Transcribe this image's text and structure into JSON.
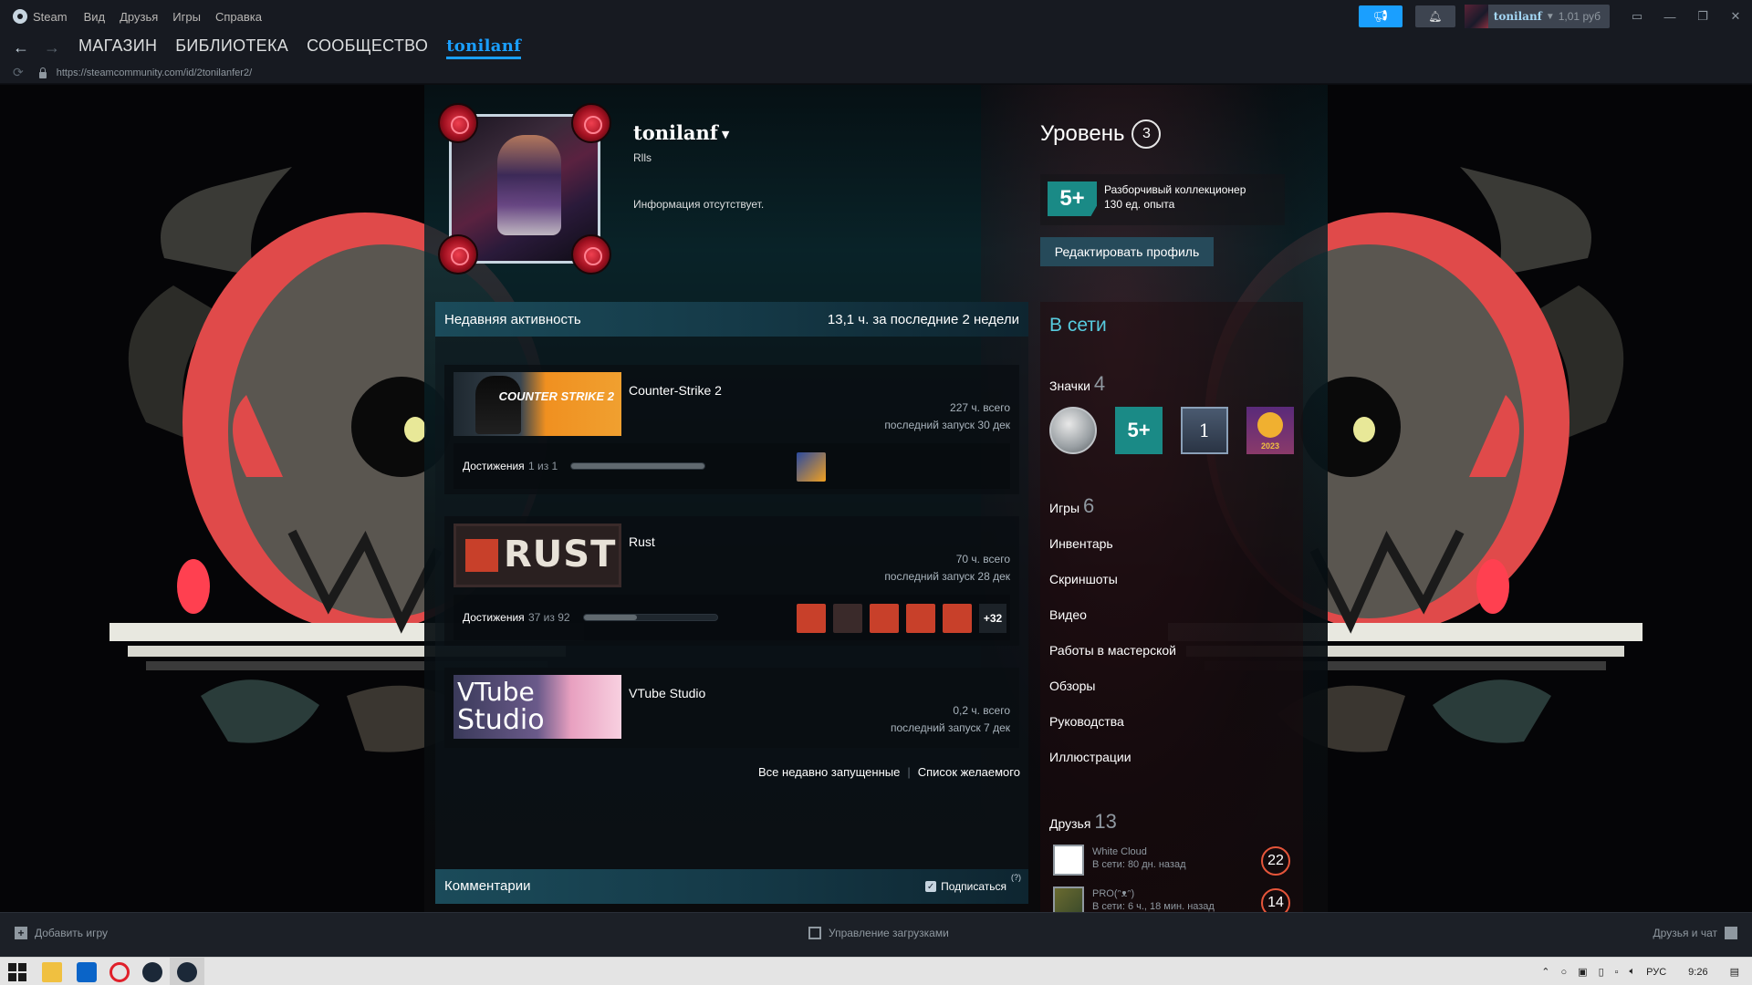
{
  "menubar": {
    "app": "Steam",
    "items": [
      "Вид",
      "Друзья",
      "Игры",
      "Справка"
    ],
    "user_name": "tonilanf",
    "balance": "1,01 руб"
  },
  "nav": {
    "links": [
      "МАГАЗИН",
      "БИБЛИОТЕКА",
      "СООБЩЕСТВО"
    ],
    "active": "tonilanf"
  },
  "url": "https://steamcommunity.com/id/2tonilanfer2/",
  "profile": {
    "name": "tonilanf",
    "real_name": "Rlls",
    "summary": "Информация отсутствует.",
    "level_label": "Уровень",
    "level": "3",
    "badge_symbol": "5+",
    "badge_name": "Разборчивый коллекционер",
    "badge_xp": "130 ед. опыта",
    "edit_button": "Редактировать профиль"
  },
  "activity": {
    "title": "Недавняя активность",
    "summary": "13,1 ч. за последние 2 недели",
    "achievements_label": "Достижения",
    "games": [
      {
        "name": "Counter-Strike 2",
        "thumb_text": "COUNTER STRIKE 2",
        "hours": "227 ч. всего",
        "last": "последний запуск 30 дек",
        "ach_count": "1 из 1",
        "ach_fraction": 1.0
      },
      {
        "name": "Rust",
        "thumb_text": "RUST",
        "hours": "70 ч. всего",
        "last": "последний запуск 28 дек",
        "ach_count": "37 из 92",
        "ach_fraction": 0.4,
        "more": "+32"
      },
      {
        "name": "VTube Studio",
        "thumb_text_1": "VTube",
        "thumb_text_2": "Studio",
        "hours": "0,2 ч. всего",
        "last": "последний запуск 7 дек"
      }
    ],
    "link_recent": "Все недавно запущенные",
    "link_sep": "|",
    "link_wishlist": "Список желаемого"
  },
  "comments": {
    "title": "Комментарии",
    "subscribe": "Подписаться",
    "help": "(?)"
  },
  "sidebar": {
    "status": "В сети",
    "badges_label": "Значки",
    "badges_count": "4",
    "badge_5": "5+",
    "badge_1": "1",
    "badge_year": "2023",
    "games_label": "Игры",
    "games_count": "6",
    "links": [
      "Инвентарь",
      "Скриншоты",
      "Видео",
      "Работы в мастерской",
      "Обзоры",
      "Руководства",
      "Иллюстрации"
    ],
    "friends_label": "Друзья",
    "friends_count": "13",
    "friends": [
      {
        "name": "White Cloud",
        "status": "В сети: 80 дн. назад",
        "level": "22"
      },
      {
        "name": "PRO(ᵔᴥᵔ)",
        "status": "В сети: 6 ч., 18 мин. назад",
        "level": "14"
      }
    ]
  },
  "bottom": {
    "add_game": "Добавить игру",
    "downloads": "Управление загрузками",
    "friends_chat": "Друзья и чат"
  },
  "taskbar": {
    "lang": "РУС",
    "time": "9:26"
  },
  "colors": {
    "accent": "#1a9fff",
    "online": "#57cbde",
    "badge_teal": "#1a8a86",
    "rust_red": "#c8402a"
  }
}
